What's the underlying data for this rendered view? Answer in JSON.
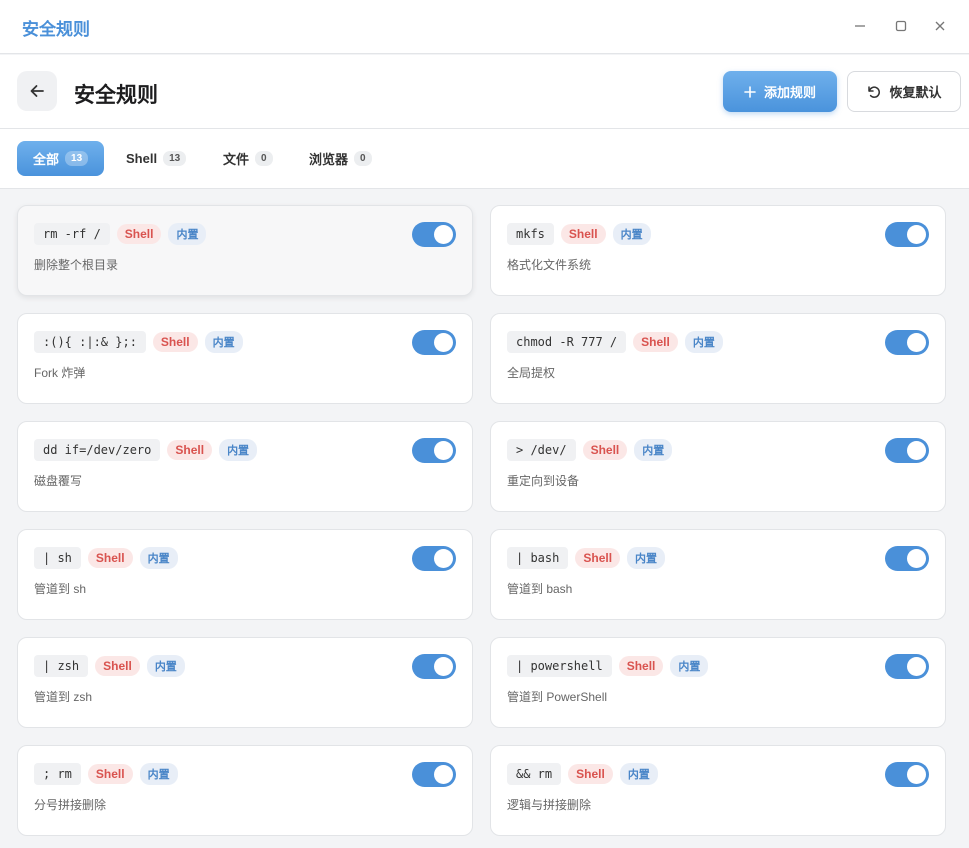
{
  "window": {
    "title": "安全规则"
  },
  "header": {
    "title": "安全规则",
    "add_label": "添加规则",
    "reset_label": "恢复默认"
  },
  "tabs": [
    {
      "label": "全部",
      "count": "13"
    },
    {
      "label": "Shell",
      "count": "13"
    },
    {
      "label": "文件",
      "count": "0"
    },
    {
      "label": "浏览器",
      "count": "0"
    }
  ],
  "rules": [
    {
      "pattern": "rm -rf /",
      "type": "Shell",
      "badge": "内置",
      "desc": "删除整个根目录",
      "enabled": true
    },
    {
      "pattern": "mkfs",
      "type": "Shell",
      "badge": "内置",
      "desc": "格式化文件系统",
      "enabled": true
    },
    {
      "pattern": ":(){ :|:& };:",
      "type": "Shell",
      "badge": "内置",
      "desc": "Fork 炸弹",
      "enabled": true
    },
    {
      "pattern": "chmod -R 777 /",
      "type": "Shell",
      "badge": "内置",
      "desc": "全局提权",
      "enabled": true
    },
    {
      "pattern": "dd if=/dev/zero",
      "type": "Shell",
      "badge": "内置",
      "desc": "磁盘覆写",
      "enabled": true
    },
    {
      "pattern": "> /dev/",
      "type": "Shell",
      "badge": "内置",
      "desc": "重定向到设备",
      "enabled": true
    },
    {
      "pattern": "| sh",
      "type": "Shell",
      "badge": "内置",
      "desc": "管道到 sh",
      "enabled": true
    },
    {
      "pattern": "| bash",
      "type": "Shell",
      "badge": "内置",
      "desc": "管道到 bash",
      "enabled": true
    },
    {
      "pattern": "| zsh",
      "type": "Shell",
      "badge": "内置",
      "desc": "管道到 zsh",
      "enabled": true
    },
    {
      "pattern": "| powershell",
      "type": "Shell",
      "badge": "内置",
      "desc": "管道到 PowerShell",
      "enabled": true
    },
    {
      "pattern": "; rm",
      "type": "Shell",
      "badge": "内置",
      "desc": "分号拼接删除",
      "enabled": true
    },
    {
      "pattern": "&& rm",
      "type": "Shell",
      "badge": "内置",
      "desc": "逻辑与拼接删除",
      "enabled": true
    }
  ],
  "colors": {
    "accent": "#4a90d9",
    "shell_tag": "#d9534f",
    "builtin_tag": "#4a86c8"
  }
}
